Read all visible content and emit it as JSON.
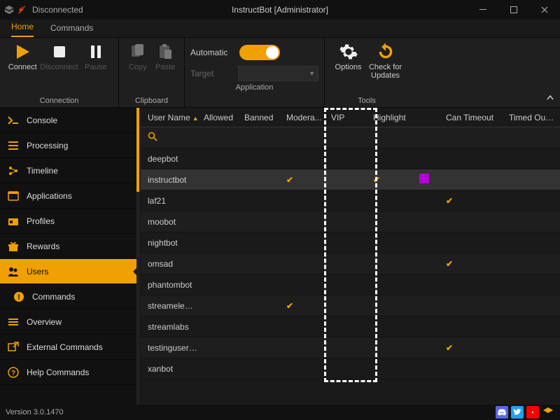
{
  "titlebar": {
    "status": "Disconnected",
    "title": "InstructBot [Administrator]"
  },
  "tabs": {
    "home": "Home",
    "commands": "Commands"
  },
  "ribbon": {
    "connection": {
      "label": "Connection",
      "connect": "Connect",
      "disconnect": "Disconnect",
      "pause": "Pause"
    },
    "clipboard": {
      "label": "Clipboard",
      "copy": "Copy",
      "paste": "Paste"
    },
    "application": {
      "label": "Application",
      "automatic_label": "Automatic",
      "automatic_on": true,
      "target_label": "Target",
      "target_value": ""
    },
    "tools": {
      "label": "Tools",
      "options": "Options",
      "check_updates": "Check for\nUpdates"
    }
  },
  "sidebar": {
    "items": [
      {
        "id": "console",
        "label": "Console"
      },
      {
        "id": "processing",
        "label": "Processing"
      },
      {
        "id": "timeline",
        "label": "Timeline"
      },
      {
        "id": "applications",
        "label": "Applications"
      },
      {
        "id": "profiles",
        "label": "Profiles"
      },
      {
        "id": "rewards",
        "label": "Rewards"
      },
      {
        "id": "users",
        "label": "Users"
      },
      {
        "id": "commands",
        "label": "Commands"
      },
      {
        "id": "overview",
        "label": "Overview"
      },
      {
        "id": "external-commands",
        "label": "External Commands"
      },
      {
        "id": "help-commands",
        "label": "Help Commands"
      }
    ]
  },
  "table": {
    "headers": {
      "user": "User Name",
      "allowed": "Allowed",
      "banned": "Banned",
      "moderator": "Modera...",
      "vip": "VIP",
      "highlight": "Highlight",
      "can_timeout": "Can Timeout",
      "timed_out": "Timed Out Until"
    },
    "rows": [
      {
        "user": "deepbot"
      },
      {
        "user": "instructbot",
        "moderator": true,
        "highlight": true,
        "highlight_color": "#b400d6",
        "selected": true
      },
      {
        "user": "laf21",
        "can_timeout": true
      },
      {
        "user": "moobot"
      },
      {
        "user": "nightbot"
      },
      {
        "user": "omsad",
        "can_timeout": true
      },
      {
        "user": "phantombot"
      },
      {
        "user": "streameleme...",
        "moderator": true
      },
      {
        "user": "streamlabs"
      },
      {
        "user": "testinguserfo...",
        "can_timeout": true
      },
      {
        "user": "xanbot"
      }
    ]
  },
  "statusbar": {
    "version": "Version 3.0.1470"
  }
}
